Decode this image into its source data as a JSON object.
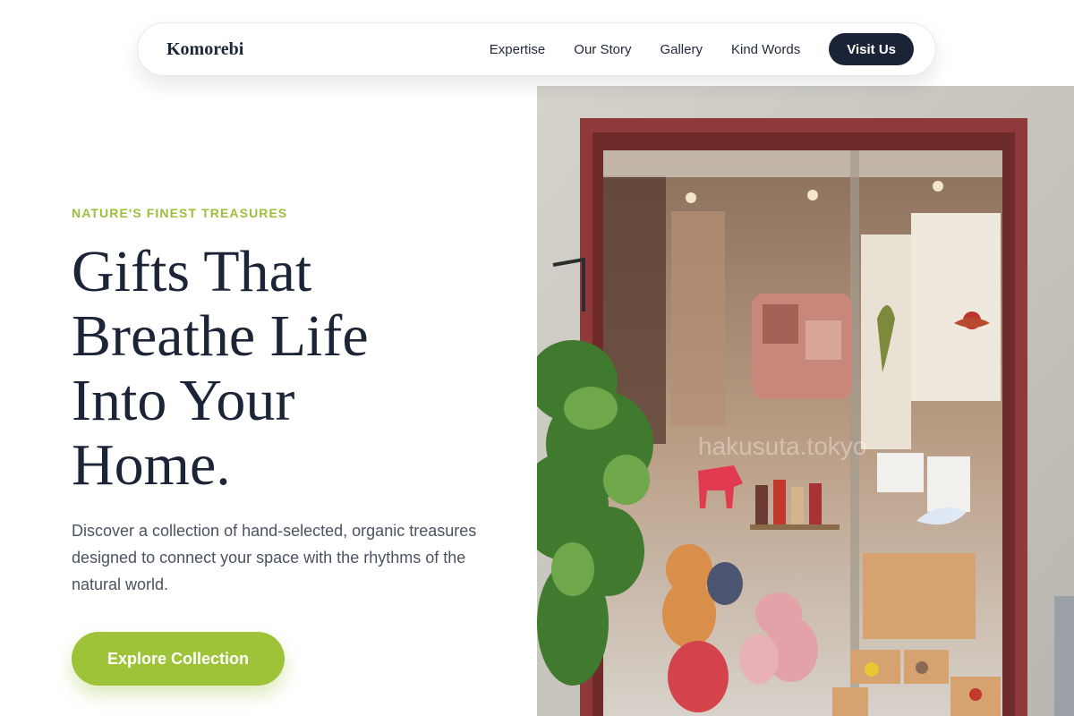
{
  "nav": {
    "brand": "Komorebi",
    "links": [
      "Expertise",
      "Our Story",
      "Gallery",
      "Kind Words"
    ],
    "cta": "Visit Us"
  },
  "hero": {
    "eyebrow": "NATURE'S FINEST TREASURES",
    "headline_lines": [
      "Gifts That",
      "Breathe Life",
      "Into Your",
      "Home."
    ],
    "description": "Discover a collection of hand-selected, organic treasures designed to connect your space with the rhythms of the natural world.",
    "cta": "Explore Collection",
    "image_watermark": "hakusuta.tokyo"
  },
  "colors": {
    "accent": "#9ec238",
    "eyebrow": "#9cbf3a",
    "navy": "#1b2436",
    "text": "#4a5361"
  }
}
